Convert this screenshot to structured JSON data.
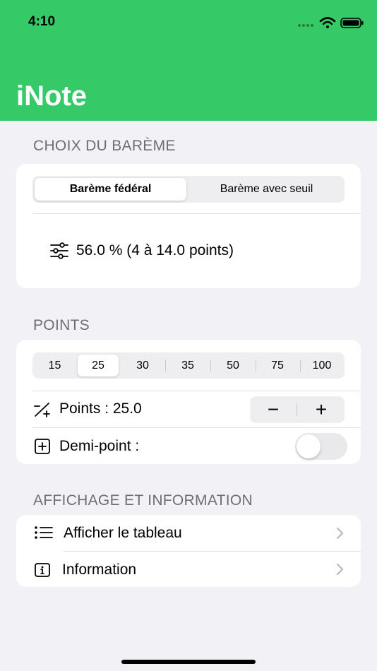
{
  "status_bar": {
    "time": "4:10"
  },
  "app": {
    "title": "iNote"
  },
  "bareme": {
    "section_label": "CHOIX DU BARÈME",
    "options": [
      "Barème fédéral",
      "Barème avec seuil"
    ],
    "selected": "Barème fédéral",
    "summary": "56.0 %  (4 à 14.0 points)"
  },
  "points": {
    "section_label": "POINTS",
    "options": [
      "15",
      "25",
      "30",
      "35",
      "50",
      "75",
      "100"
    ],
    "selected": "25",
    "points_label": "Points : 25.0",
    "stepper": {
      "minus": "−",
      "plus": "+"
    },
    "demi_point_label": "Demi-point :",
    "demi_point_enabled": false
  },
  "affichage": {
    "section_label": "AFFICHAGE ET INFORMATION",
    "items": [
      {
        "label": "Afficher le tableau"
      },
      {
        "label": "Information"
      }
    ]
  },
  "colors": {
    "header": "#35c967",
    "background": "#f2f1f6",
    "card": "#ffffff",
    "section_label": "#6e6e73"
  }
}
